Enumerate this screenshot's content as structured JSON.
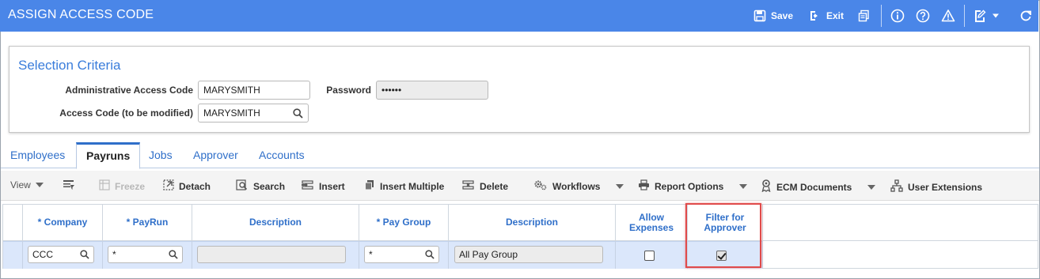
{
  "window": {
    "title": "ASSIGN ACCESS CODE",
    "actions": {
      "save": "Save",
      "exit": "Exit"
    }
  },
  "selection": {
    "title": "Selection Criteria",
    "admin_label": "Administrative Access Code",
    "admin_value": "MARYSMITH",
    "password_label": "Password",
    "password_value": "••••••",
    "access_label": "Access Code (to be modified)",
    "access_value": "MARYSMITH"
  },
  "tabs": [
    "Employees",
    "Payruns",
    "Jobs",
    "Approver",
    "Accounts"
  ],
  "active_tab": "Payruns",
  "toolbar": {
    "view": "View",
    "freeze": "Freeze",
    "detach": "Detach",
    "search": "Search",
    "insert": "Insert",
    "insert_multiple": "Insert Multiple",
    "delete": "Delete",
    "workflows": "Workflows",
    "report_options": "Report Options",
    "ecm_documents": "ECM Documents",
    "user_extensions": "User Extensions"
  },
  "grid": {
    "headers": {
      "company": "* Company",
      "payrun": "* PayRun",
      "description1": "Description",
      "pay_group": "* Pay Group",
      "description2": "Description",
      "allow_expenses_1": "Allow",
      "allow_expenses_2": "Expenses",
      "filter_approver_1": "Filter for",
      "filter_approver_2": "Approver"
    },
    "row": {
      "company": "CCC",
      "payrun": "*",
      "description1": "",
      "pay_group": "*",
      "description2": "All Pay Group",
      "allow_expenses": false,
      "filter_for_approver": true
    }
  },
  "colors": {
    "accent": "#4a86e8",
    "link": "#2f6fc9",
    "highlight": "#e04a4a",
    "row_selected": "#dbe7fb"
  }
}
